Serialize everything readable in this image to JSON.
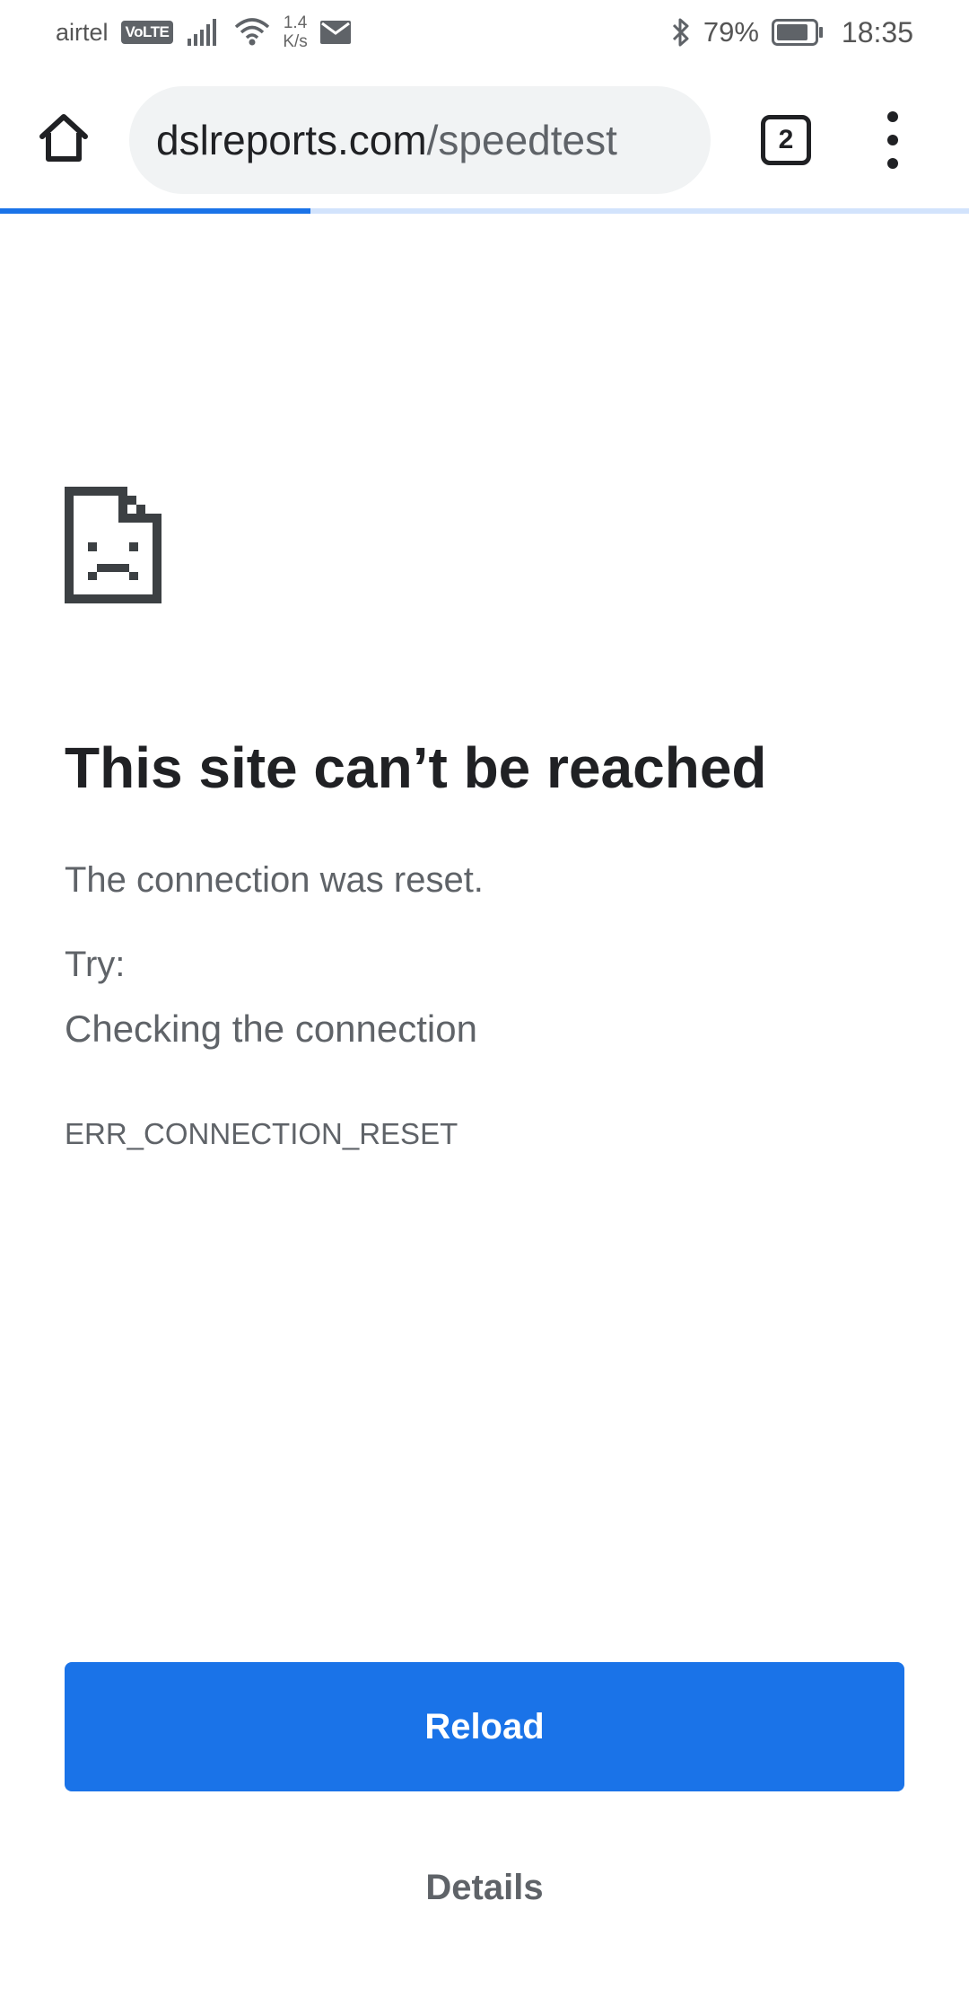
{
  "status_bar": {
    "carrier": "airtel",
    "volte": "VoLTE",
    "speed_value": "1.4",
    "speed_unit": "K/s",
    "battery_pct": "79%",
    "time": "18:35"
  },
  "toolbar": {
    "url_host": "dslreports.com",
    "url_path": "/speedtest",
    "tab_count": "2"
  },
  "page_load_progress": 0.32,
  "error": {
    "title": "This site can’t be reached",
    "description": "The connection was reset.",
    "try_label": "Try:",
    "suggestion": "Checking the connection",
    "code": "ERR_CONNECTION_RESET"
  },
  "buttons": {
    "reload": "Reload",
    "details": "Details"
  },
  "colors": {
    "accent": "#1a73e8",
    "progress_track": "#d2e3fc",
    "text_primary": "#202124",
    "text_secondary": "#5f6368"
  },
  "icons": {
    "home": "home-icon",
    "tab_switcher": "tab-switcher-icon",
    "menu": "more-vert-icon",
    "error": "sad-page-icon"
  }
}
